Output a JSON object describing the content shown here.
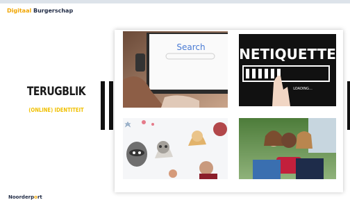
{
  "brand": {
    "part1": "Digitaal",
    "part2": "Burgerschap"
  },
  "slide": {
    "title": "TERUGBLIK",
    "subtitle": "(ONLINE) IDENTITEIT"
  },
  "images": {
    "search": {
      "word": "Search"
    },
    "netiquette": {
      "word": "NETIQUETTE",
      "loading": "LOADING..."
    },
    "memes": {},
    "selfie": {}
  },
  "footer": {
    "part1": "Noorderp",
    "part2": "o",
    "part3": "rt"
  },
  "colors": {
    "accent": "#f0a500",
    "subtitle": "#f0c000",
    "navy": "#1f2a44"
  }
}
